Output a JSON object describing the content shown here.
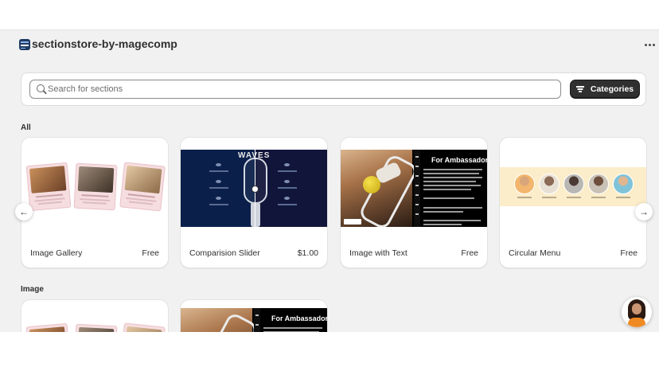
{
  "app": {
    "title": "sectionstore-by-magecomp",
    "logo_icon": "sectionstore-logo-icon",
    "more_icon": "more-horizontal-icon"
  },
  "search": {
    "placeholder": "Search for sections",
    "value": "",
    "icon": "search-icon"
  },
  "categories_button": {
    "label": "Categories",
    "icon": "filter-icon"
  },
  "sections": [
    {
      "title": "All",
      "cards": [
        {
          "name": "Image Gallery",
          "price": "Free",
          "thumb": "image-gallery"
        },
        {
          "name": "Comparision Slider",
          "price": "$1.00",
          "thumb": "comparison-slider"
        },
        {
          "name": "Image with Text",
          "price": "Free",
          "thumb": "image-with-text"
        },
        {
          "name": "Circular Menu",
          "price": "Free",
          "thumb": "circular-menu"
        }
      ]
    },
    {
      "title": "Image",
      "cards": [
        {
          "name": "",
          "price": "",
          "thumb": "image-gallery"
        },
        {
          "name": "",
          "price": "",
          "thumb": "image-with-text"
        }
      ]
    }
  ],
  "thumbnails": {
    "comparison_heading": "WAVES",
    "image_with_text_heading": "For Ambassadors"
  },
  "carousel": {
    "prev_icon": "arrow-left-icon",
    "next_icon": "arrow-right-icon"
  },
  "chat": {
    "icon": "support-agent-avatar"
  },
  "colors": {
    "primary_button": "#303030",
    "app_background": "#f1f1f1",
    "card_background": "#ffffff"
  }
}
